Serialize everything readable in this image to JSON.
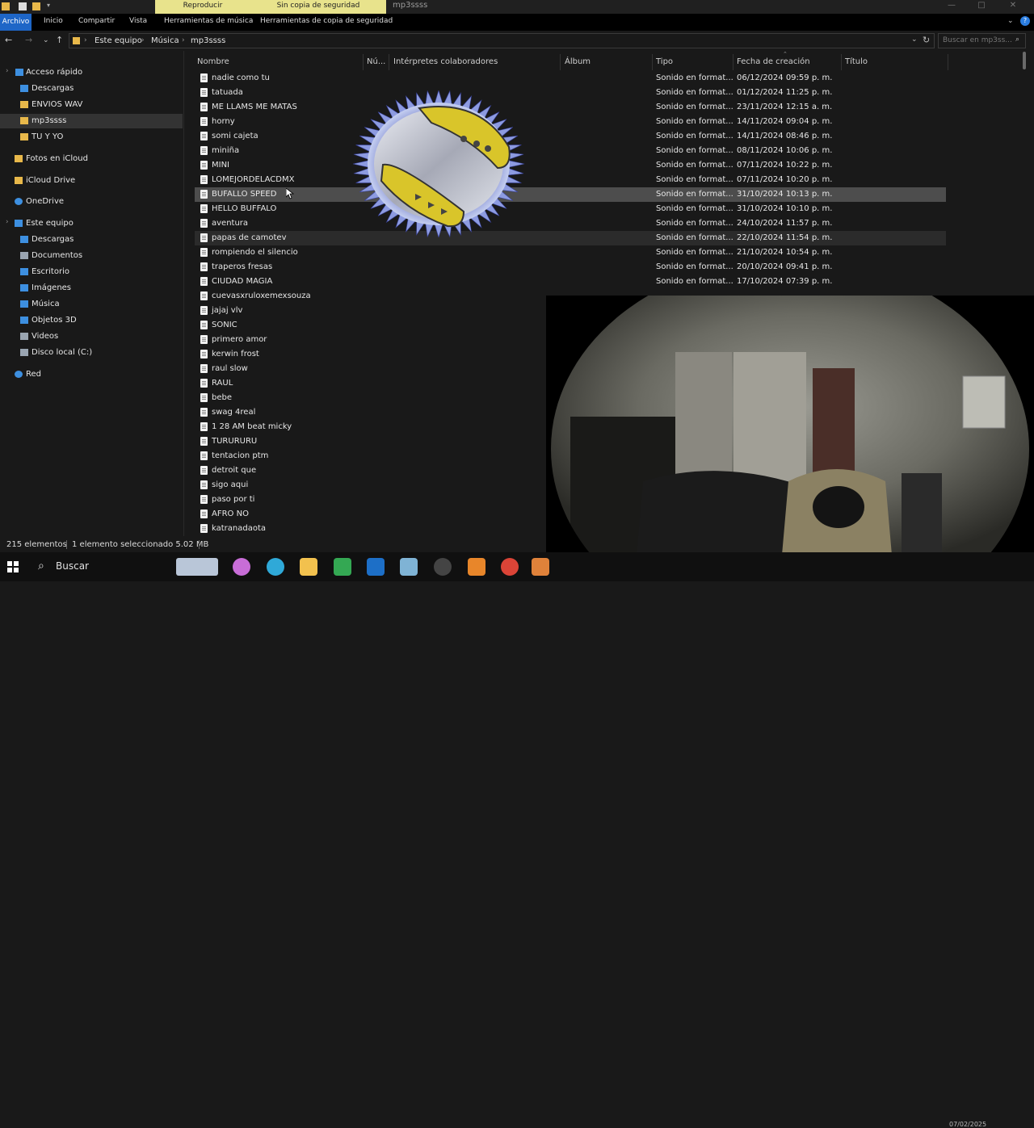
{
  "window": {
    "title": "mp3ssss",
    "context_tab_play": "Reproducir",
    "context_tab_backup": "Sin copia de seguridad",
    "minimize_glyph": "—",
    "maximize_glyph": "□",
    "close_glyph": "✕"
  },
  "ribbon": {
    "tabs": [
      "Archivo",
      "Inicio",
      "Compartir",
      "Vista",
      "Herramientas de música",
      "Herramientas de copia de seguridad"
    ]
  },
  "address": {
    "crumbs": [
      "Este equipo",
      "Música",
      "mp3ssss"
    ],
    "search_placeholder": "Buscar en mp3ss..."
  },
  "sidebar": {
    "items": [
      {
        "label": "Acceso rápido",
        "icon": "star-icon",
        "color": "#3d8fe0"
      },
      {
        "label": "Descargas",
        "icon": "download-icon",
        "color": "#3d8fe0"
      },
      {
        "label": "ENVIOS WAV",
        "icon": "folder-icon",
        "color": "#e8b84a"
      },
      {
        "label": "mp3ssss",
        "icon": "folder-icon",
        "color": "#e8b84a"
      },
      {
        "label": "TU Y YO",
        "icon": "folder-icon",
        "color": "#e8b84a"
      },
      {
        "label": "Fotos en iCloud",
        "icon": "folder-icon",
        "color": "#e8b84a"
      },
      {
        "label": "iCloud Drive",
        "icon": "folder-icon",
        "color": "#e8b84a"
      },
      {
        "label": "OneDrive",
        "icon": "cloud-icon",
        "color": "#3d8fe0"
      },
      {
        "label": "Este equipo",
        "icon": "computer-icon",
        "color": "#3d8fe0"
      },
      {
        "label": "Descargas",
        "icon": "download-icon",
        "color": "#3d8fe0"
      },
      {
        "label": "Documentos",
        "icon": "documents-icon",
        "color": "#9aa5b1"
      },
      {
        "label": "Escritorio",
        "icon": "desktop-icon",
        "color": "#3d8fe0"
      },
      {
        "label": "Imágenes",
        "icon": "pictures-icon",
        "color": "#3d8fe0"
      },
      {
        "label": "Música",
        "icon": "music-icon",
        "color": "#3d8fe0"
      },
      {
        "label": "Objetos 3D",
        "icon": "cube-icon",
        "color": "#3d8fe0"
      },
      {
        "label": "Videos",
        "icon": "video-icon",
        "color": "#9aa5b1"
      },
      {
        "label": "Disco local (C:)",
        "icon": "drive-icon",
        "color": "#9aa5b1"
      },
      {
        "label": "Red",
        "icon": "network-icon",
        "color": "#3d8fe0"
      }
    ]
  },
  "columns": [
    "Nombre",
    "Nú...",
    "Intérpretes colaboradores",
    "Álbum",
    "Tipo",
    "Fecha de creación",
    "Título"
  ],
  "files": [
    {
      "name": "nadie como tu",
      "type": "Sonido en format...",
      "date": "06/12/2024 09:59 p. m."
    },
    {
      "name": "tatuada",
      "type": "Sonido en format...",
      "date": "01/12/2024 11:25 p. m."
    },
    {
      "name": "ME LLAMS ME MATAS",
      "type": "Sonido en format...",
      "date": "23/11/2024 12:15 a. m."
    },
    {
      "name": "horny",
      "type": "Sonido en format...",
      "date": "14/11/2024 09:04 p. m."
    },
    {
      "name": "somi cajeta",
      "type": "Sonido en format...",
      "date": "14/11/2024 08:46 p. m."
    },
    {
      "name": "miniña",
      "type": "Sonido en format...",
      "date": "08/11/2024 10:06 p. m."
    },
    {
      "name": "MINI",
      "type": "Sonido en format...",
      "date": "07/11/2024 10:22 p. m."
    },
    {
      "name": "LOMEJORDELACDMX",
      "type": "Sonido en format...",
      "date": "07/11/2024 10:20 p. m."
    },
    {
      "name": "BUFALLO SPEED",
      "type": "Sonido en format...",
      "date": "31/10/2024 10:13 p. m."
    },
    {
      "name": "HELLO BUFFALO",
      "type": "Sonido en format...",
      "date": "31/10/2024 10:10 p. m."
    },
    {
      "name": "aventura",
      "type": "Sonido en format...",
      "date": "24/10/2024 11:57 p. m."
    },
    {
      "name": "papas de camotev",
      "type": "Sonido en format...",
      "date": "22/10/2024 11:54 p. m."
    },
    {
      "name": "rompiendo el silencio",
      "type": "Sonido en format...",
      "date": "21/10/2024 10:54 p. m."
    },
    {
      "name": "traperos fresas",
      "type": "Sonido en format...",
      "date": "20/10/2024 09:41 p. m."
    },
    {
      "name": "CIUDAD MAGIA",
      "type": "Sonido en format...",
      "date": "17/10/2024 07:39 p. m."
    },
    {
      "name": "cuevasxruloxemexsouza",
      "type": "",
      "date": ""
    },
    {
      "name": "jajaj vlv",
      "type": "",
      "date": ""
    },
    {
      "name": "SONIC",
      "type": "",
      "date": ""
    },
    {
      "name": "primero amor",
      "type": "",
      "date": ""
    },
    {
      "name": "kerwin frost",
      "type": "",
      "date": ""
    },
    {
      "name": "raul slow",
      "type": "",
      "date": ""
    },
    {
      "name": "RAUL",
      "type": "",
      "date": ""
    },
    {
      "name": "bebe",
      "type": "",
      "date": ""
    },
    {
      "name": "swag 4real",
      "type": "",
      "date": ""
    },
    {
      "name": "1 28 AM beat micky",
      "type": "",
      "date": ""
    },
    {
      "name": "TURURURU",
      "type": "",
      "date": ""
    },
    {
      "name": "tentacion ptm",
      "type": "",
      "date": ""
    },
    {
      "name": "detroit que",
      "type": "",
      "date": ""
    },
    {
      "name": "sigo aqui",
      "type": "",
      "date": ""
    },
    {
      "name": "paso por ti",
      "type": "",
      "date": ""
    },
    {
      "name": "AFRO NO",
      "type": "",
      "date": ""
    },
    {
      "name": "katranadaota",
      "type": "",
      "date": ""
    }
  ],
  "status": {
    "count": "215 elementos",
    "selection": "1 elemento seleccionado  5.02 MB"
  },
  "taskbar": {
    "search_label": "Buscar",
    "apps": [
      {
        "name": "copilot-icon",
        "color": "#c86dd7"
      },
      {
        "name": "edge-icon",
        "color": "#2fa9d8"
      },
      {
        "name": "file-explorer-icon",
        "color": "#f2c14e"
      },
      {
        "name": "google-drive-icon",
        "color": "#34a853"
      },
      {
        "name": "outlook-icon",
        "color": "#1d6fc7"
      },
      {
        "name": "notes-icon",
        "color": "#7fb3d5"
      },
      {
        "name": "obs-icon",
        "color": "#444444"
      },
      {
        "name": "fl-studio-icon",
        "color": "#e8862a"
      },
      {
        "name": "chrome-icon",
        "color": "#db4437"
      },
      {
        "name": "media-player-icon",
        "color": "#e0823a"
      }
    ]
  },
  "webcam": {
    "date": "07/02/2025"
  }
}
